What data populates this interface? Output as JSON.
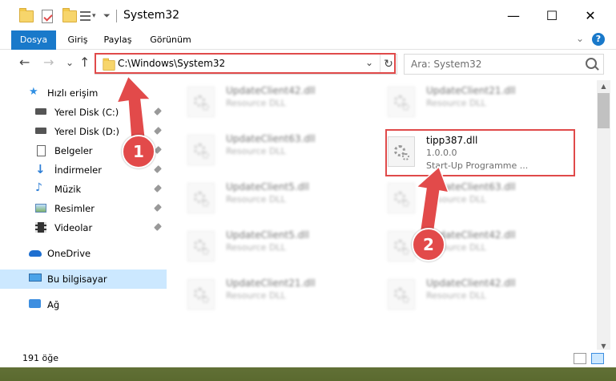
{
  "window": {
    "title": "System32",
    "controls": {
      "minimize": "—",
      "maximize": "☐",
      "close": "✕"
    }
  },
  "ribbon": {
    "tabs": [
      "Dosya",
      "Giriş",
      "Paylaş",
      "Görünüm"
    ],
    "help": "?",
    "collapse": "⌄"
  },
  "navigation": {
    "back": "←",
    "forward": "→",
    "recent": "⌄",
    "up": "↑",
    "address": "C:\\Windows\\System32",
    "address_dropdown": "⌄",
    "refresh": "↻",
    "search_placeholder": "Ara: System32"
  },
  "sidebar": {
    "quick_access": "Hızlı erişim",
    "items": [
      {
        "label": "Yerel Disk (C:)",
        "icon": "drive-icon"
      },
      {
        "label": "Yerel Disk (D:)",
        "icon": "drive-icon"
      },
      {
        "label": "Belgeler",
        "icon": "documents-icon"
      },
      {
        "label": "İndirmeler",
        "icon": "downloads-icon"
      },
      {
        "label": "Müzik",
        "icon": "music-icon"
      },
      {
        "label": "Resimler",
        "icon": "pictures-icon"
      },
      {
        "label": "Videolar",
        "icon": "videos-icon"
      }
    ],
    "onedrive": "OneDrive",
    "this_pc": "Bu bilgisayar",
    "network": "Ağ"
  },
  "files": {
    "left_column": [
      {
        "name": "UpdateClient42.dll",
        "desc": "Resource DLL"
      },
      {
        "name": "UpdateClient63.dll",
        "desc": "Resource DLL"
      },
      {
        "name": "UpdateClient5.dll",
        "desc": "Resource DLL"
      },
      {
        "name": "UpdateClient5.dll",
        "desc": "Resource DLL"
      },
      {
        "name": "UpdateClient21.dll",
        "desc": "Resource DLL"
      }
    ],
    "right_column": [
      {
        "name": "UpdateClient21.dll",
        "desc": "Resource DLL"
      },
      {
        "name": "UpdateClient63.dll",
        "desc": "Resource DLL"
      },
      {
        "name": "UpdateClient42.dll",
        "desc": "Resource DLL"
      },
      {
        "name": "UpdateClient42.dll",
        "desc": "Resource DLL"
      }
    ],
    "highlighted": {
      "name": "tipp387.dll",
      "version": "1.0.0.0",
      "desc": "Start-Up Programme ..."
    }
  },
  "status": {
    "count": "191 öğe"
  },
  "callouts": [
    "1",
    "2"
  ],
  "colors": {
    "accent": "#1979ca",
    "highlight": "#e04a4a",
    "selection": "#cce8ff"
  }
}
